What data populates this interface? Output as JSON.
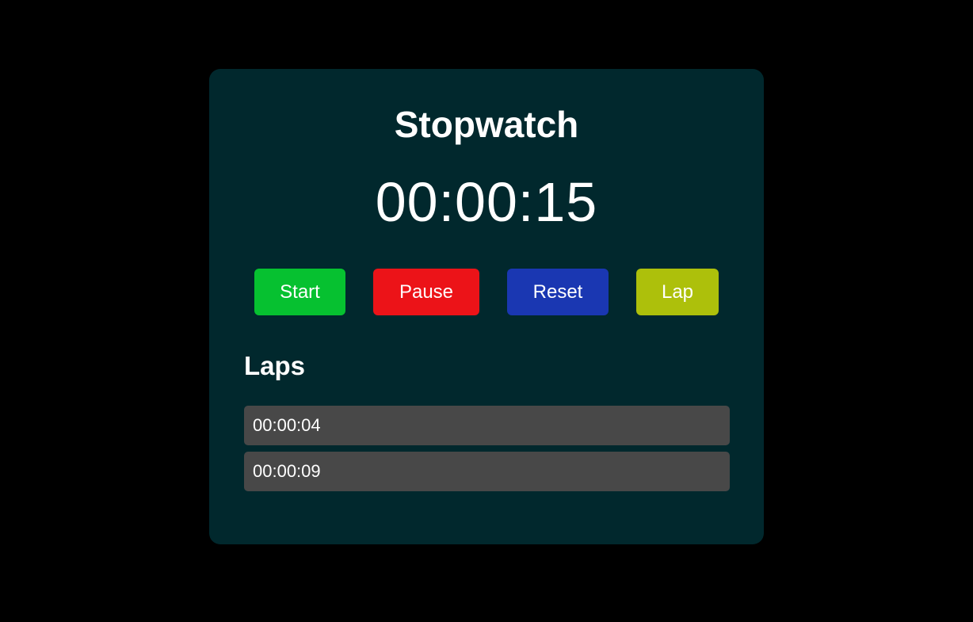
{
  "app": {
    "title": "Stopwatch",
    "time": "00:00:15"
  },
  "controls": [
    {
      "label": "Start",
      "color": "#06c130"
    },
    {
      "label": "Pause",
      "color": "#ec1318"
    },
    {
      "label": "Reset",
      "color": "#1a37b2"
    },
    {
      "label": "Lap",
      "color": "#adc00b"
    }
  ],
  "laps": {
    "heading": "Laps",
    "items": [
      "00:00:04",
      "00:00:09"
    ]
  }
}
